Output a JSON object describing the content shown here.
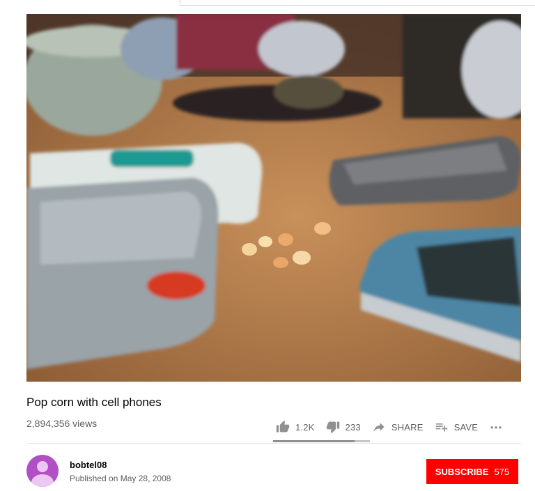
{
  "video": {
    "title": "Pop corn with cell phones",
    "views": "2,894,356 views",
    "like_ratio": 0.84
  },
  "actions": {
    "likes": "1.2K",
    "dislikes": "233",
    "share": "SHARE",
    "save": "SAVE"
  },
  "channel": {
    "name": "bobtel08",
    "published": "Published on May 28, 2008"
  },
  "subscribe": {
    "label": "SUBSCRIBE",
    "count": "575"
  },
  "colors": {
    "subscribe_bg": "#ff0000",
    "avatar_bg": "#b24fc5",
    "secondary_text": "#606060"
  },
  "icons": [
    "thumb-up-icon",
    "thumb-down-icon",
    "share-icon",
    "playlist-add-icon",
    "more-icon",
    "default-avatar-icon"
  ]
}
